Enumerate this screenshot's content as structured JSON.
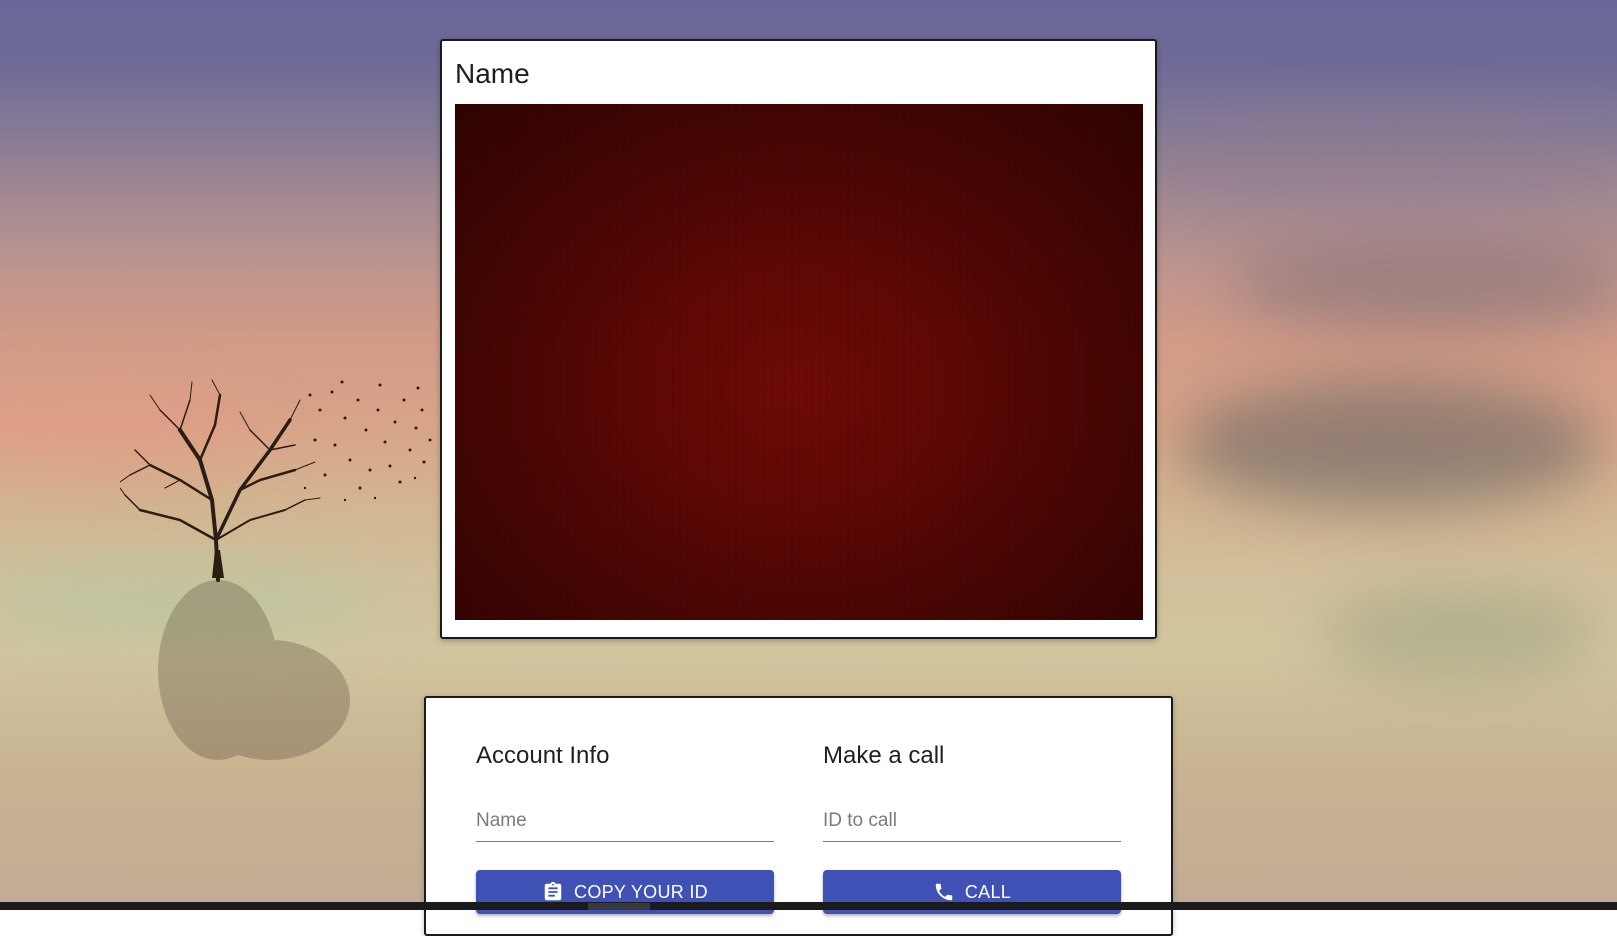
{
  "video_panel": {
    "title": "Name"
  },
  "account_info": {
    "heading": "Account Info",
    "name_field": {
      "placeholder": "Name",
      "value": ""
    },
    "copy_button": {
      "label": "COPY YOUR ID",
      "icon": "clipboard-icon"
    }
  },
  "make_call": {
    "heading": "Make a call",
    "id_field": {
      "placeholder": "ID to call",
      "value": ""
    },
    "call_button": {
      "label": "CALL",
      "icon": "phone-icon"
    }
  },
  "colors": {
    "button": "#3f51b5",
    "video_background": "#5f0805",
    "card": "#ffffff"
  }
}
